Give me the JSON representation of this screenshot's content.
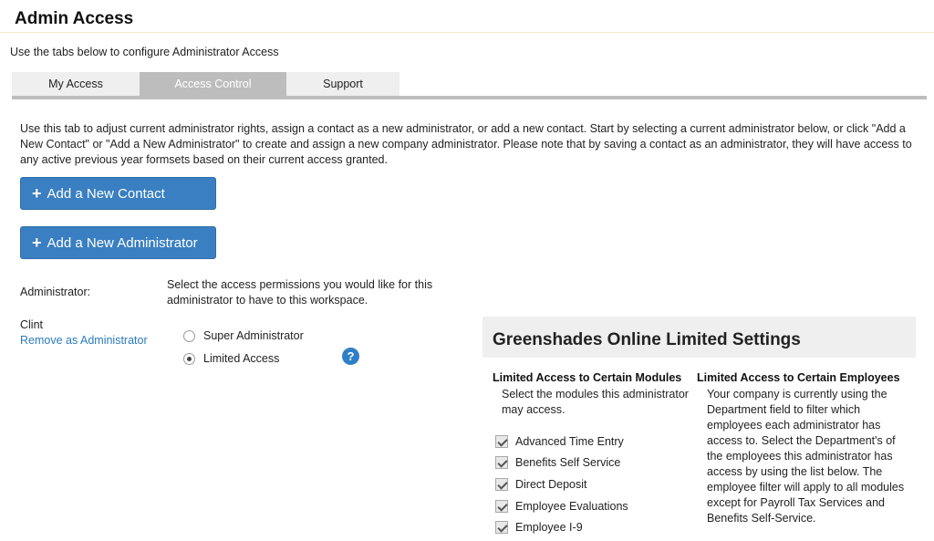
{
  "header": {
    "title": "Admin Access"
  },
  "intro": "Use the tabs below to configure Administrator Access",
  "tabs": [
    {
      "label": "My Access"
    },
    {
      "label": "Access Control"
    },
    {
      "label": "Support"
    }
  ],
  "description": "Use this tab to adjust current administrator rights, assign a contact as a new administrator, or add a new contact. Start by selecting a current administrator below, or click \"Add a New Contact\" or \"Add a New Administrator\" to create and assign a new company administrator. Please note that by saving a contact as an administrator, they will have access to any active previous year formsets based on their current access granted.",
  "buttons": {
    "add_contact": "Add a New Contact",
    "add_admin": "Add a New Administrator"
  },
  "admin": {
    "label": "Administrator:",
    "select_prompt": "Select the access permissions you would like for this administrator to have to this workspace.",
    "name": "Clint",
    "remove_link": "Remove as Administrator",
    "options": [
      {
        "label": "Super Administrator",
        "selected": false
      },
      {
        "label": "Limited Access",
        "selected": true
      }
    ],
    "help_glyph": "?"
  },
  "limited_settings": {
    "title": "Greenshades Online Limited Settings",
    "modules": {
      "title": "Limited Access to Certain Modules",
      "description": "Select the modules this administrator may access.",
      "items": [
        {
          "label": "Advanced Time Entry",
          "checked": true
        },
        {
          "label": "Benefits Self Service",
          "checked": true
        },
        {
          "label": "Direct Deposit",
          "checked": true
        },
        {
          "label": "Employee Evaluations",
          "checked": true
        },
        {
          "label": "Employee I-9",
          "checked": true
        }
      ]
    },
    "employees": {
      "title": "Limited Access to Certain Employees",
      "description": "Your company is currently using the Department field to filter which employees each administrator has access to. Select the Department's of the employees this administrator has access by using the list below. The employee filter will apply to all modules except for Payroll Tax Services and Benefits Self-Service."
    }
  }
}
